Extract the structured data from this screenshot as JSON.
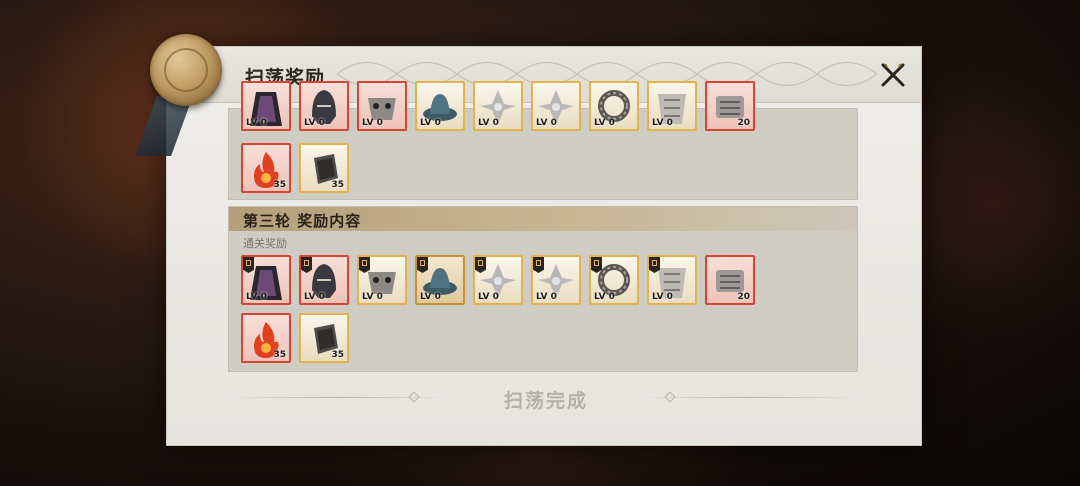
{
  "dialog": {
    "title": "扫荡奖励",
    "close_icon": "close-x-icon"
  },
  "round_previous": {
    "items": [
      {
        "icon": "cloak-icon",
        "label": "LV 0",
        "rarity": "red"
      },
      {
        "icon": "helmet-icon",
        "label": "LV 0",
        "rarity": "red"
      },
      {
        "icon": "mask-icon",
        "label": "LV 0",
        "rarity": "red"
      },
      {
        "icon": "hat-icon",
        "label": "LV 0",
        "rarity": "gold"
      },
      {
        "icon": "ornament-icon",
        "label": "LV 0",
        "rarity": "gold"
      },
      {
        "icon": "ornament-icon",
        "label": "LV 0",
        "rarity": "gold"
      },
      {
        "icon": "bracelet-icon",
        "label": "LV 0",
        "rarity": "gold"
      },
      {
        "icon": "armor-icon",
        "label": "LV 0",
        "rarity": "gold"
      },
      {
        "icon": "gauntlet-icon",
        "label": "20",
        "rarity": "red"
      }
    ],
    "extra": [
      {
        "icon": "fire-essence-icon",
        "label": "35",
        "rarity": "red"
      },
      {
        "icon": "iron-block-icon",
        "label": "35",
        "rarity": "gold"
      }
    ]
  },
  "round_three": {
    "title": "第三轮 奖励内容",
    "subtitle": "通关奖励",
    "items": [
      {
        "icon": "cloak-icon",
        "label": "LV 0",
        "rarity": "red",
        "tag": true
      },
      {
        "icon": "helmet-icon",
        "label": "LV 0",
        "rarity": "red",
        "tag": true
      },
      {
        "icon": "mask-icon",
        "label": "LV 0",
        "rarity": "gold",
        "tag": true
      },
      {
        "icon": "hat-icon",
        "label": "LV 0",
        "rarity": "darkgold",
        "tag": true
      },
      {
        "icon": "ornament-icon",
        "label": "LV 0",
        "rarity": "gold",
        "tag": true
      },
      {
        "icon": "ornament-icon",
        "label": "LV 0",
        "rarity": "gold",
        "tag": true
      },
      {
        "icon": "bracelet-icon",
        "label": "LV 0",
        "rarity": "gold",
        "tag": true
      },
      {
        "icon": "armor-icon",
        "label": "LV 0",
        "rarity": "gold",
        "tag": true
      },
      {
        "icon": "gauntlet-icon",
        "label": "20",
        "rarity": "red",
        "tag": false
      }
    ],
    "extra": [
      {
        "icon": "fire-essence-icon",
        "label": "35",
        "rarity": "red"
      },
      {
        "icon": "iron-block-icon",
        "label": "35",
        "rarity": "gold"
      }
    ]
  },
  "footer": {
    "title": "扫荡完成"
  },
  "colors": {
    "gold_border": "#e2b24b",
    "red_border": "#d64533",
    "section_bar": "#b59f7b"
  }
}
